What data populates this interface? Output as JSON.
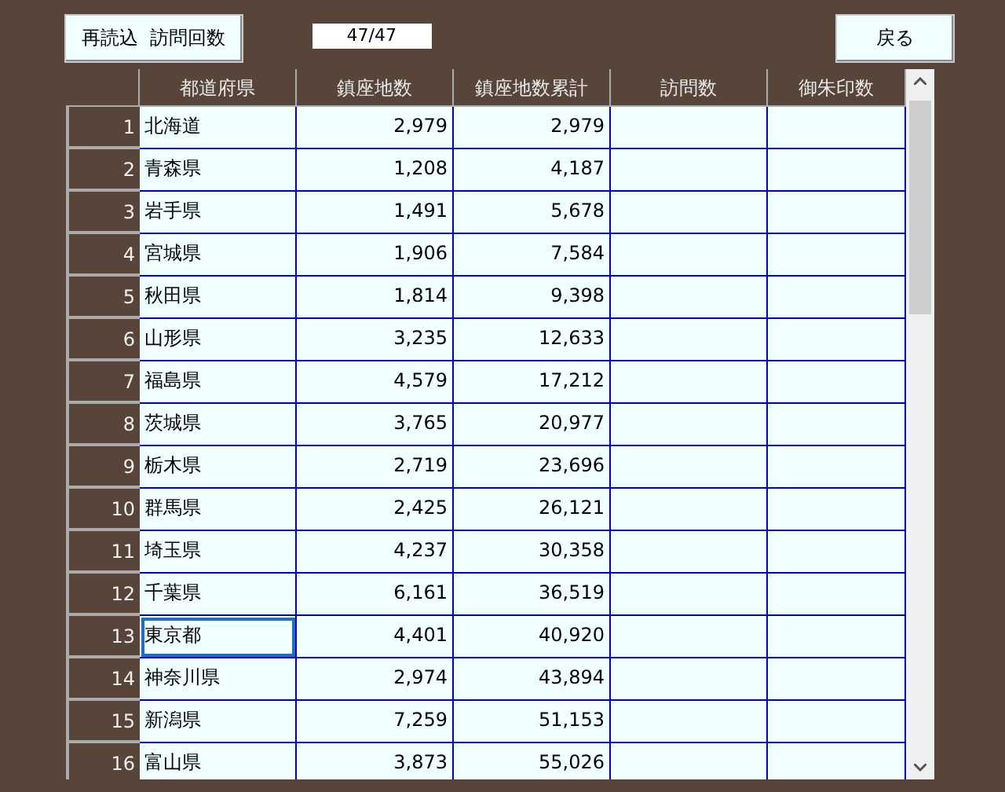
{
  "toolbar": {
    "reload_button": "再読込  訪問回数",
    "counter": "47/47",
    "back_button": "戻る"
  },
  "table": {
    "columns": [
      "都道府県",
      "鎮座地数",
      "鎮座地数累計",
      "訪問数",
      "御朱印数"
    ],
    "rows": [
      {
        "no": "1",
        "prefecture": "北海道",
        "count": "2,979",
        "cumulative": "2,979",
        "selected": false
      },
      {
        "no": "2",
        "prefecture": "青森県",
        "count": "1,208",
        "cumulative": "4,187",
        "selected": false
      },
      {
        "no": "3",
        "prefecture": "岩手県",
        "count": "1,491",
        "cumulative": "5,678",
        "selected": false
      },
      {
        "no": "4",
        "prefecture": "宮城県",
        "count": "1,906",
        "cumulative": "7,584",
        "selected": false
      },
      {
        "no": "5",
        "prefecture": "秋田県",
        "count": "1,814",
        "cumulative": "9,398",
        "selected": false
      },
      {
        "no": "6",
        "prefecture": "山形県",
        "count": "3,235",
        "cumulative": "12,633",
        "selected": false
      },
      {
        "no": "7",
        "prefecture": "福島県",
        "count": "4,579",
        "cumulative": "17,212",
        "selected": false
      },
      {
        "no": "8",
        "prefecture": "茨城県",
        "count": "3,765",
        "cumulative": "20,977",
        "selected": false
      },
      {
        "no": "9",
        "prefecture": "栃木県",
        "count": "2,719",
        "cumulative": "23,696",
        "selected": false
      },
      {
        "no": "10",
        "prefecture": "群馬県",
        "count": "2,425",
        "cumulative": "26,121",
        "selected": false
      },
      {
        "no": "11",
        "prefecture": "埼玉県",
        "count": "4,237",
        "cumulative": "30,358",
        "selected": false
      },
      {
        "no": "12",
        "prefecture": "千葉県",
        "count": "6,161",
        "cumulative": "36,519",
        "selected": false
      },
      {
        "no": "13",
        "prefecture": "東京都",
        "count": "4,401",
        "cumulative": "40,920",
        "selected": true
      },
      {
        "no": "14",
        "prefecture": "神奈川県",
        "count": "2,974",
        "cumulative": "43,894",
        "selected": false
      },
      {
        "no": "15",
        "prefecture": "新潟県",
        "count": "7,259",
        "cumulative": "51,153",
        "selected": false
      },
      {
        "no": "16",
        "prefecture": "富山県",
        "count": "3,873",
        "cumulative": "55,026",
        "selected": false
      }
    ]
  }
}
